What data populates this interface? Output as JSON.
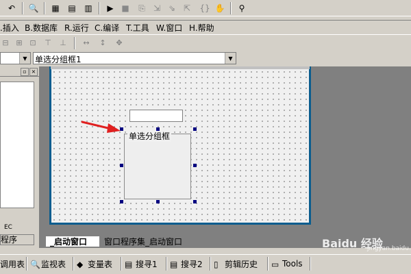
{
  "menu": {
    "items": [
      {
        "label": ".插入"
      },
      {
        "label": "B.数据库"
      },
      {
        "label": "R.运行"
      },
      {
        "label": "C.编译"
      },
      {
        "label": "T.工具"
      },
      {
        "label": "W.窗口"
      },
      {
        "label": "H.帮助"
      }
    ]
  },
  "combos": {
    "left_value": "",
    "right_value": "单选分组框1"
  },
  "form": {
    "groupbox_caption": "单选分组框",
    "arrow_color": "#e02020"
  },
  "left_panel": {
    "ec_label": "EC",
    "tab_label": "程序"
  },
  "tabs": {
    "startup": "_启动窗口",
    "procs": "窗口程序集_启动窗口"
  },
  "bottom": {
    "items": [
      {
        "label": "调用表"
      },
      {
        "label": "监视表"
      },
      {
        "label": "变量表"
      },
      {
        "label": "搜寻1"
      },
      {
        "label": "搜寻2"
      },
      {
        "label": "剪辑历史"
      },
      {
        "label": "Tools"
      }
    ]
  },
  "watermark": {
    "brand": "Baidu 经验",
    "url": "jingyan.baidu.com"
  },
  "colors": {
    "accent": "#0a5d8e",
    "handle": "#000080"
  }
}
